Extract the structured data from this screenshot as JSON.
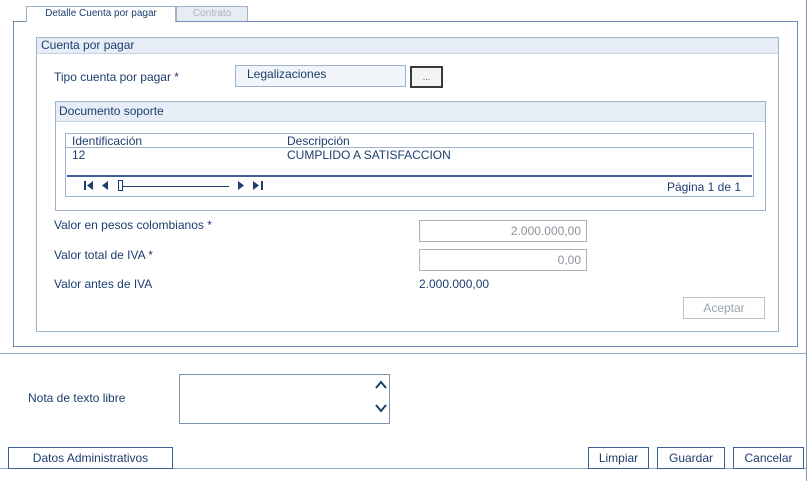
{
  "tabs": [
    {
      "label": "Detalle Cuenta por pagar",
      "active": true
    },
    {
      "label": "Contrato",
      "active": false
    }
  ],
  "cuenta": {
    "legend": "Cuenta por pagar",
    "tipo_label": "Tipo cuenta por pagar *",
    "tipo_value": "Legalizaciones",
    "lookup_button": "..."
  },
  "documento": {
    "title": "Documento soporte",
    "columns": [
      "Identificación",
      "Descripción"
    ],
    "rows": [
      {
        "identificacion": "12",
        "descripcion": "CUMPLIDO A SATISFACCION"
      }
    ],
    "pager": {
      "first_icon": "first-page-icon",
      "prev_icon": "prev-page-icon",
      "next_icon": "next-page-icon",
      "last_icon": "last-page-icon",
      "page_label": "Página 1 de 1"
    }
  },
  "valores": {
    "pesos_label": "Valor en pesos colombianos *",
    "pesos_value": "2.000.000,00",
    "iva_label": "Valor total de IVA *",
    "iva_value": "0,00",
    "antes_iva_label": "Valor antes de IVA",
    "antes_iva_value": "2.000.000,00",
    "aceptar_label": "Aceptar"
  },
  "nota": {
    "label": "Nota de texto libre",
    "value": ""
  },
  "footer": {
    "datos_admin_label": "Datos Administrativos",
    "limpiar_label": "Limpiar",
    "guardar_label": "Guardar",
    "cancelar_label": "Cancelar"
  },
  "colors": {
    "text": "#1d3d6e",
    "border": "#9fb3cc",
    "header_bg": "#e6edf6",
    "disabled_text": "#9aa3ad"
  }
}
